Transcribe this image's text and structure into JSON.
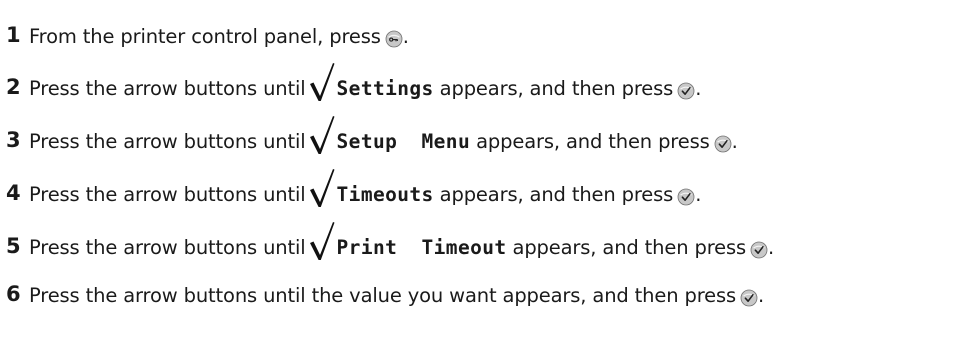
{
  "steps": [
    {
      "number": "1",
      "before": "From the printer control panel, press",
      "menu": "",
      "after": "",
      "button_icon": "menu-key-icon",
      "end": "."
    },
    {
      "number": "2",
      "before": "Press the arrow buttons until",
      "menu": "Settings",
      "after": "appears, and then press",
      "button_icon": "select-button-icon",
      "end": "."
    },
    {
      "number": "3",
      "before": "Press the arrow buttons until",
      "menu": "Setup  Menu",
      "after": "appears, and then press",
      "button_icon": "select-button-icon",
      "end": "."
    },
    {
      "number": "4",
      "before": "Press the arrow buttons until",
      "menu": "Timeouts",
      "after": "appears, and then press",
      "button_icon": "select-button-icon",
      "end": "."
    },
    {
      "number": "5",
      "before": "Press the arrow buttons until",
      "menu": "Print  Timeout",
      "after": "appears, and then press",
      "button_icon": "select-button-icon",
      "end": "."
    },
    {
      "number": "6",
      "before": "Press the arrow buttons until the value you want appears, and then press",
      "menu": "",
      "after": "",
      "button_icon": "select-button-icon",
      "end": "."
    }
  ],
  "colors": {
    "text": "#1a1a1a",
    "icon_fill": "#c8c8c8",
    "icon_stroke": "#707070"
  },
  "icons": {
    "checkmark": "checkmark-icon"
  }
}
